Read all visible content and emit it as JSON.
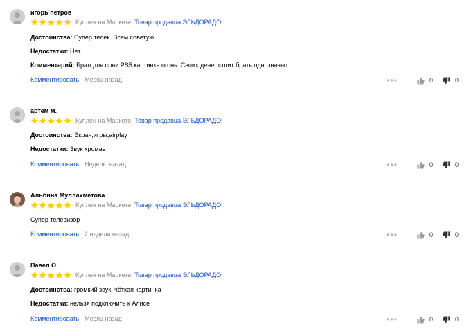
{
  "colors": {
    "star": "#ffcc00",
    "link": "#1a55c9",
    "muted": "#8a8a8a",
    "icon": "#9a9a9a"
  },
  "reviews": [
    {
      "author": "игорь петров",
      "rating": 5,
      "bought": "Куплен на Маркете",
      "seller": "Товар продавца ЭЛЬДОРАДО",
      "pros_label": "Достоинства:",
      "pros": "Супер телек. Всем советую.",
      "cons_label": "Недостатки:",
      "cons": "Нет.",
      "comment_label": "Комментарий:",
      "comment": "Брал для сони PS5 картинка огонь. Своих денег стоит брать однозначно.",
      "comment_link": "Комментировать",
      "time": "Месяц назад",
      "likes": "0",
      "dislikes": "0"
    },
    {
      "author": "артем м.",
      "rating": 5,
      "bought": "Куплен на Маркете",
      "seller": "Товар продавца ЭЛЬДОРАДО",
      "pros_label": "Достоинства:",
      "pros": "Экран,игры,airplay",
      "cons_label": "Недостатки:",
      "cons": "Звук хромает",
      "comment_link": "Комментировать",
      "time": "Неделю назад",
      "likes": "0",
      "dislikes": "0"
    },
    {
      "author": "Альбина Муллахметова",
      "rating": 5,
      "bought": "Куплен на Маркете",
      "seller": "Товар продавца ЭЛЬДОРАДО",
      "text": "Супер телевизор",
      "comment_link": "Комментировать",
      "time": "2 недели назад",
      "likes": "0",
      "dislikes": "0"
    },
    {
      "author": "Павел О.",
      "rating": 5,
      "bought": "Куплен на Маркете",
      "seller": "Товар продавца ЭЛЬДОРАДО",
      "pros_label": "Достоинства:",
      "pros": "громкий звук, чёткая картинка",
      "cons_label": "Недостатки:",
      "cons": "нельзя подключить к Алисе",
      "comment_link": "Комментировать",
      "time": "Месяц назад",
      "likes": "0",
      "dislikes": "0"
    }
  ]
}
